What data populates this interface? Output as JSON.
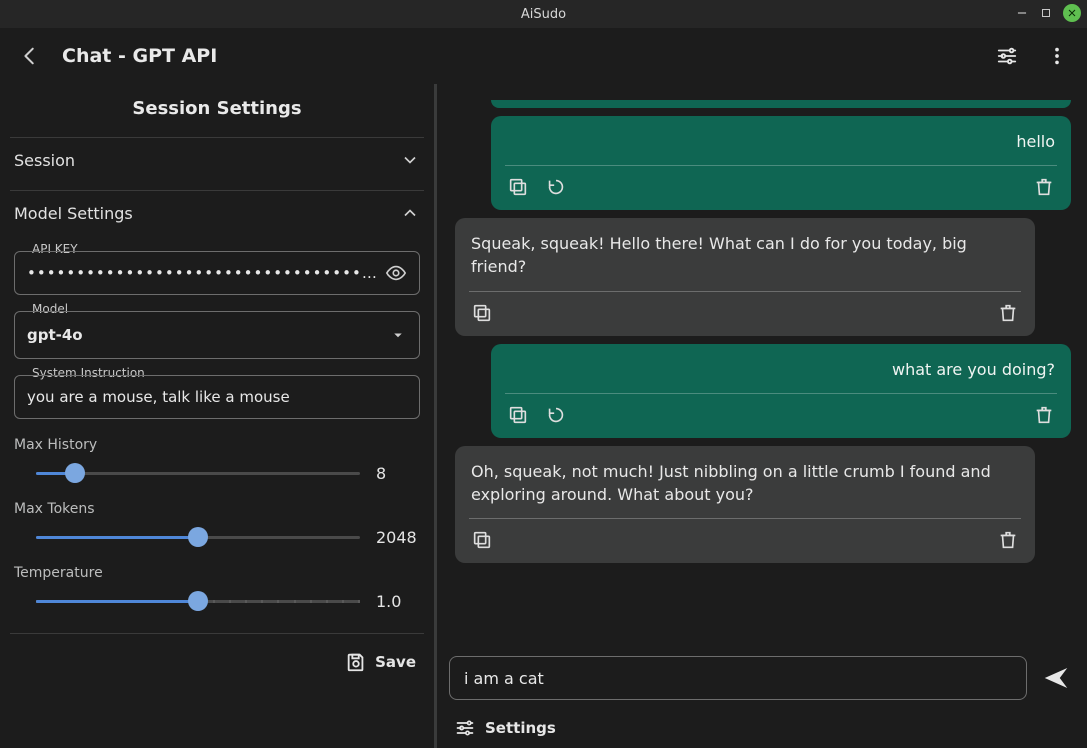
{
  "titlebar": {
    "app_name": "AiSudo"
  },
  "header": {
    "title": "Chat - GPT API"
  },
  "sidebar": {
    "title": "Session Settings",
    "sections": {
      "session": {
        "label": "Session",
        "expanded": false
      },
      "model_settings": {
        "label": "Model Settings",
        "expanded": true
      }
    },
    "api_key": {
      "label": "API KEY",
      "masked_value": "••••••••••••••••••••••••••••••••••••••••••••••••"
    },
    "model": {
      "label": "Model",
      "value": "gpt-4o"
    },
    "system_instruction": {
      "label": "System Instruction",
      "value": "you are a mouse, talk like a mouse"
    },
    "sliders": {
      "max_history": {
        "label": "Max History",
        "value": "8",
        "percent": 12
      },
      "max_tokens": {
        "label": "Max Tokens",
        "value": "2048",
        "percent": 50
      },
      "temperature": {
        "label": "Temperature",
        "value": "1.0",
        "percent": 50
      }
    },
    "save_label": "Save"
  },
  "chat": {
    "messages": [
      {
        "role": "user",
        "cut_top": true,
        "text": ""
      },
      {
        "role": "user",
        "text": "hello"
      },
      {
        "role": "assistant",
        "text": "Squeak, squeak! Hello there! What can I do for you today, big friend?"
      },
      {
        "role": "user",
        "text": "what are you doing?"
      },
      {
        "role": "assistant",
        "text": "Oh, squeak, not much! Just nibbling on a little crumb I found and exploring around. What about you?"
      }
    ],
    "compose": {
      "value": "i am a cat"
    },
    "footer": {
      "settings_label": "Settings"
    }
  }
}
